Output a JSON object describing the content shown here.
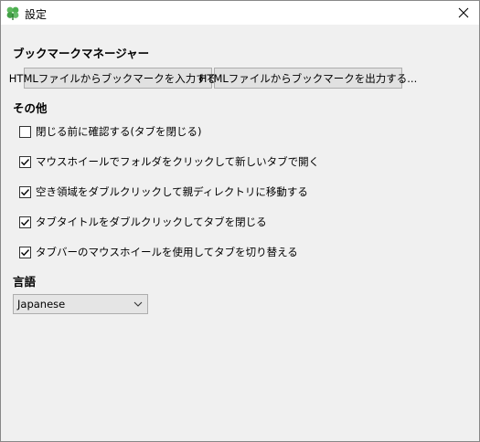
{
  "window": {
    "title": "設定",
    "icon": "clover-icon"
  },
  "bookmark_manager": {
    "heading": "ブックマークマネージャー",
    "import_button": "HTMLファイルからブックマークを入力する...",
    "export_button": "HTMLファイルからブックマークを出力する..."
  },
  "other": {
    "heading": "その他",
    "options": [
      {
        "label": "閉じる前に確認する(タブを閉じる)",
        "checked": false
      },
      {
        "label": "マウスホイールでフォルダをクリックして新しいタブで開く",
        "checked": true
      },
      {
        "label": "空き領域をダブルクリックして親ディレクトリに移動する",
        "checked": true
      },
      {
        "label": "タブタイトルをダブルクリックしてタブを閉じる",
        "checked": true
      },
      {
        "label": "タブバーのマウスホイールを使用してタブを切り替える",
        "checked": true
      }
    ]
  },
  "language": {
    "heading": "言語",
    "selected": "Japanese"
  },
  "colors": {
    "icon_green": "#4caf50",
    "window_bg": "#f0f0f0",
    "button_bg": "#e1e1e1"
  }
}
